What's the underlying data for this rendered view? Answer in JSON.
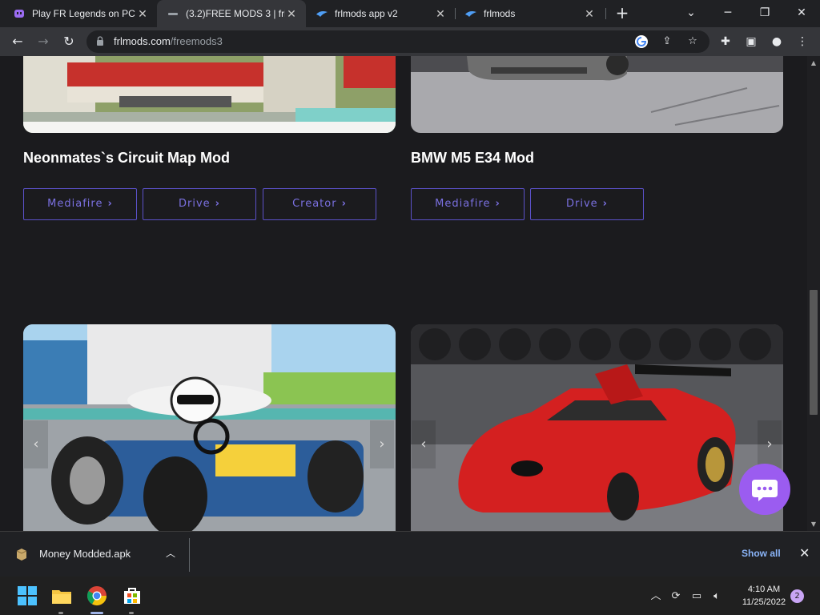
{
  "browser": {
    "tabs": [
      {
        "title": "Play FR Legends on PC",
        "active": false
      },
      {
        "title": "(3.2)FREE MODS 3 | frl",
        "active": true
      },
      {
        "title": "frlmods app v2",
        "active": false
      },
      {
        "title": "frlmods",
        "active": false
      }
    ],
    "tab_close_glyph": "✕",
    "new_tab_glyph": "+",
    "url_domain": "frlmods.com",
    "url_path": "/freemods3"
  },
  "page": {
    "mods": [
      {
        "title": "Neonmates`s Circuit Map Mod",
        "buttons": [
          "Mediafire",
          "Drive",
          "Creator"
        ]
      },
      {
        "title": "BMW M5 E34 Mod",
        "buttons": [
          "Mediafire",
          "Drive"
        ]
      }
    ],
    "carousel_prev": "‹",
    "carousel_next": "›"
  },
  "download_bar": {
    "filename": "Money Modded.apk",
    "show_all": "Show all"
  },
  "taskbar": {
    "time": "4:10 AM",
    "date": "11/25/2022",
    "notification_count": "2"
  },
  "colors": {
    "accent": "#5b51c9",
    "chat_bubble": "#9b5cf0",
    "background": "#1b1b1e"
  }
}
